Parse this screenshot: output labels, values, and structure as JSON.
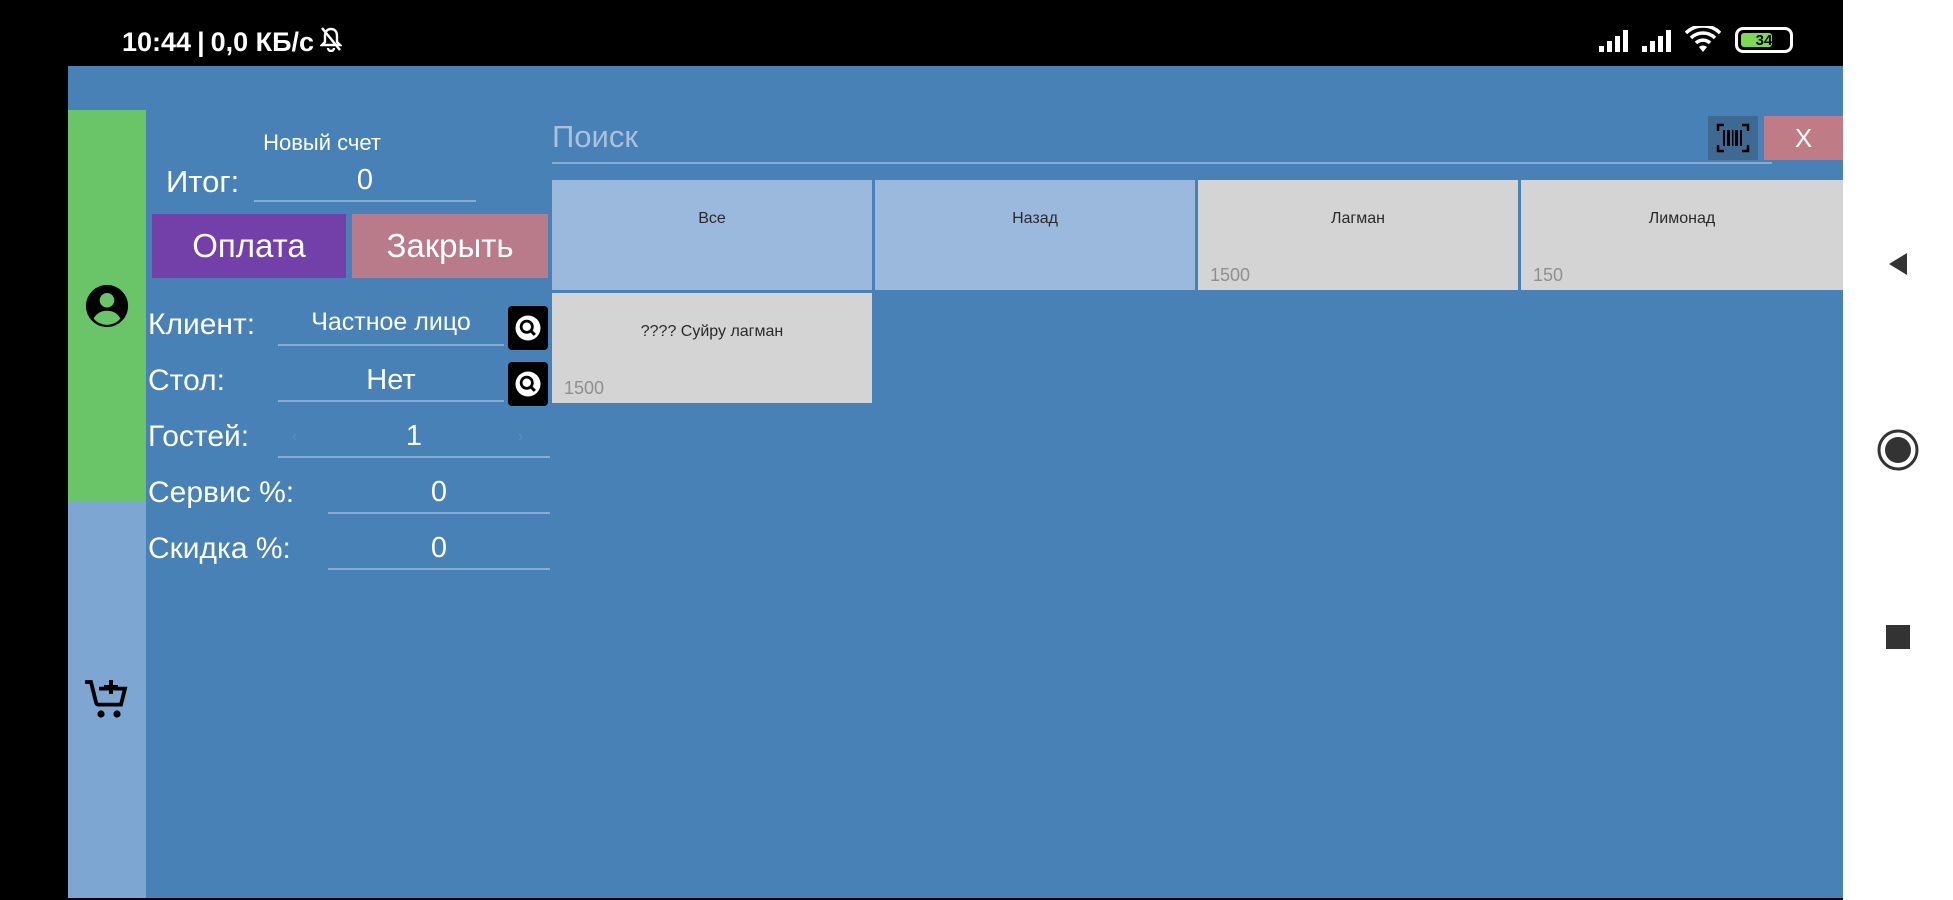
{
  "status_bar": {
    "time": "10:44",
    "network_speed": "0,0 КБ/с",
    "battery_level": "34",
    "icons": [
      "mute-icon",
      "signal-icon",
      "signal-icon",
      "wifi-icon",
      "battery-icon"
    ]
  },
  "side_nav": {
    "items": [
      {
        "icon": "account-circle-icon",
        "active": true,
        "color": "#6ac468"
      },
      {
        "icon": "add-to-cart-icon",
        "active": false,
        "color": "#7ea6d3"
      }
    ]
  },
  "order": {
    "title": "Новый счет",
    "total_label": "Итог:",
    "total_value": "0",
    "pay_label": "Оплата",
    "close_label": "Закрыть",
    "client_label": "Клиент:",
    "client_value": "Частное лицо",
    "table_label": "Стол:",
    "table_value": "Нет",
    "guests_label": "Гостей:",
    "guests_value": "1",
    "guests_dec": "‹",
    "guests_inc": "›",
    "service_label": "Сервис %:",
    "service_value": "0",
    "discount_label": "Скидка %:",
    "discount_value": "0"
  },
  "search": {
    "placeholder": "Поиск",
    "clear_label": "X"
  },
  "tiles": [
    {
      "name": "Все",
      "price": ""
    },
    {
      "name": "Назад",
      "price": ""
    },
    {
      "name": "Лагман",
      "price": "1500"
    },
    {
      "name": "Лимонад",
      "price": "150"
    },
    {
      "name": "???? Суйру лагман",
      "price": "1500"
    }
  ],
  "colors": {
    "app_background": "#4781b5",
    "pay_button": "#7240a8",
    "close_button": "#b97b8a",
    "tile": "#d4d4d4",
    "tile_category": "#9bb9dc"
  }
}
